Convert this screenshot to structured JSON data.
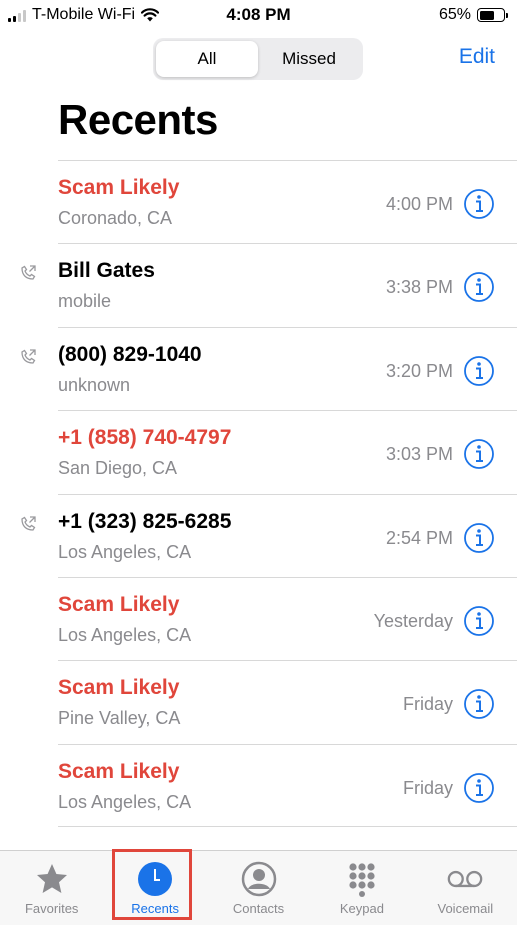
{
  "status_bar": {
    "carrier": "T-Mobile Wi-Fi",
    "time": "4:08 PM",
    "battery": "65%",
    "battery_level": 0.65
  },
  "header": {
    "segments": [
      {
        "label": "All",
        "selected": true
      },
      {
        "label": "Missed",
        "selected": false
      }
    ],
    "edit_label": "Edit",
    "title": "Recents"
  },
  "calls": [
    {
      "name": "Scam Likely",
      "detail": "Coronado, CA",
      "time": "4:00 PM",
      "missed": true,
      "outgoing": false
    },
    {
      "name": "Bill Gates",
      "detail": "mobile",
      "time": "3:38 PM",
      "missed": false,
      "outgoing": true
    },
    {
      "name": "(800) 829-1040",
      "detail": "unknown",
      "time": "3:20 PM",
      "missed": false,
      "outgoing": true
    },
    {
      "name": "+1 (858) 740-4797",
      "detail": "San Diego, CA",
      "time": "3:03 PM",
      "missed": true,
      "outgoing": false
    },
    {
      "name": "+1 (323) 825-6285",
      "detail": "Los Angeles, CA",
      "time": "2:54 PM",
      "missed": false,
      "outgoing": true
    },
    {
      "name": "Scam Likely",
      "detail": "Los Angeles, CA",
      "time": "Yesterday",
      "missed": true,
      "outgoing": false
    },
    {
      "name": "Scam Likely",
      "detail": "Pine Valley, CA",
      "time": "Friday",
      "missed": true,
      "outgoing": false
    },
    {
      "name": "Scam Likely",
      "detail": "Los Angeles, CA",
      "time": "Friday",
      "missed": true,
      "outgoing": false
    }
  ],
  "tabs": [
    {
      "label": "Favorites",
      "icon": "star-icon",
      "active": false
    },
    {
      "label": "Recents",
      "icon": "clock-icon",
      "active": true
    },
    {
      "label": "Contacts",
      "icon": "contact-icon",
      "active": false
    },
    {
      "label": "Keypad",
      "icon": "keypad-icon",
      "active": false
    },
    {
      "label": "Voicemail",
      "icon": "voicemail-icon",
      "active": false
    }
  ],
  "colors": {
    "accent": "#1a73e8",
    "missed": "#e0463b",
    "secondary_text": "#8a8a8e",
    "highlight_box": "#e0463b"
  }
}
